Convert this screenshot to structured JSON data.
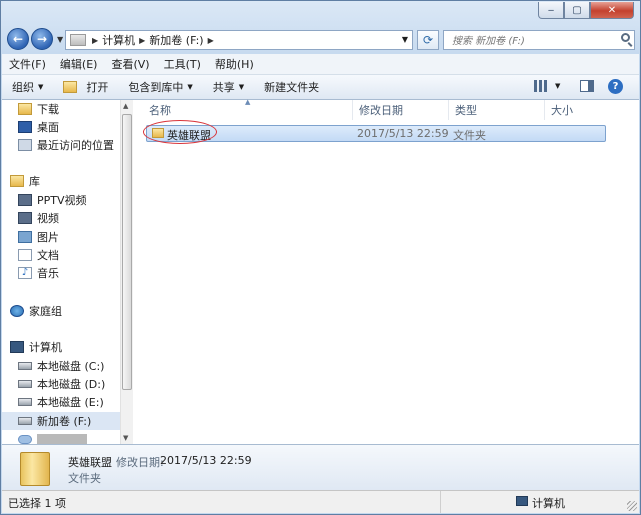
{
  "address": {
    "crumbs": [
      "计算机",
      "新加卷 (F:)"
    ]
  },
  "search": {
    "placeholder": "搜索 新加卷 (F:)"
  },
  "menu": [
    "文件(F)",
    "编辑(E)",
    "查看(V)",
    "工具(T)",
    "帮助(H)"
  ],
  "toolbar": {
    "organize": "组织",
    "open": "打开",
    "include": "包含到库中",
    "share": "共享",
    "new_folder": "新建文件夹"
  },
  "nav": {
    "favorites": [
      "下载",
      "桌面",
      "最近访问的位置"
    ],
    "library": "库",
    "library_items": [
      "PPTV视频",
      "视频",
      "图片",
      "文档",
      "音乐"
    ],
    "homegroup": "家庭组",
    "computer": "计算机",
    "drives": [
      "本地磁盘 (C:)",
      "本地磁盘 (D:)",
      "本地磁盘 (E:)",
      "新加卷 (F:)"
    ]
  },
  "columns": {
    "name": "名称",
    "date": "修改日期",
    "type": "类型",
    "size": "大小"
  },
  "files": [
    {
      "name": "英雄联盟",
      "date": "2017/5/13 22:59",
      "type": "文件夹",
      "size": ""
    }
  ],
  "details": {
    "name": "英雄联盟",
    "modified_label": "修改日期:",
    "modified": "2017/5/13 22:59",
    "type": "文件夹"
  },
  "status": {
    "selected": "已选择 1 项",
    "location": "计算机"
  },
  "colors": {
    "selection": "#cce0f7",
    "annotation": "#d9343a"
  }
}
